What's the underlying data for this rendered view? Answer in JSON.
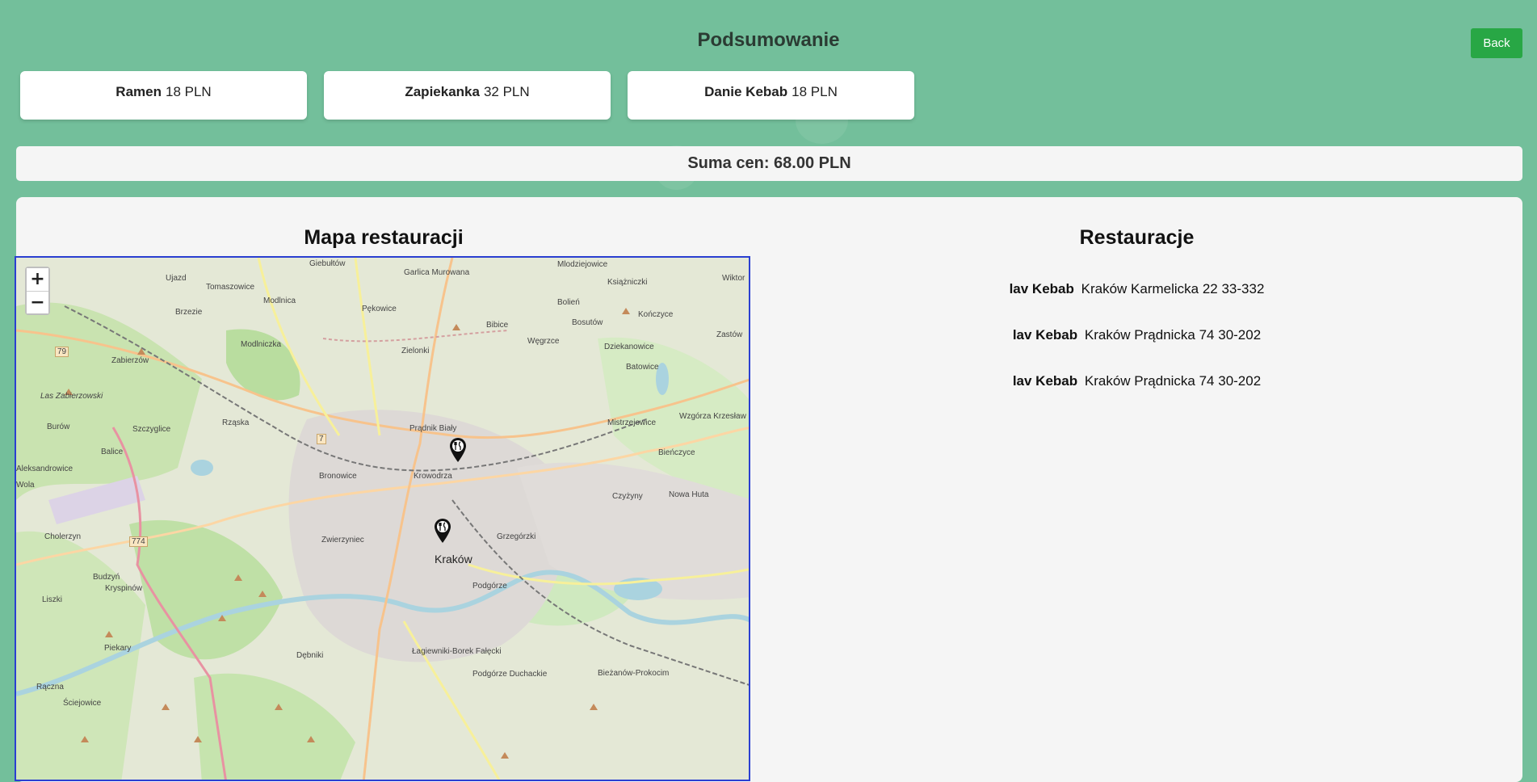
{
  "page": {
    "title": "Podsumowanie",
    "back_label": "Back"
  },
  "items": [
    {
      "name": "Ramen",
      "price": "18 PLN"
    },
    {
      "name": "Zapiekanka",
      "price": "32 PLN"
    },
    {
      "name": "Danie Kebab",
      "price": "18 PLN"
    }
  ],
  "summary": {
    "text": "Suma cen: 68.00 PLN"
  },
  "map": {
    "title": "Mapa restauracji",
    "zoom_in": "+",
    "zoom_out": "−",
    "city_label": "Kraków",
    "labels": [
      "Giebułtów",
      "Ujazd",
      "Tomaszowice",
      "Zielonki",
      "Bibice",
      "Węgrzce",
      "Bolień",
      "Bosutów",
      "Dziekanowice",
      "Batowice",
      "Zastów",
      "Wiktor",
      "Mlodziejowice",
      "Książniczki",
      "Kończyce",
      "Zabierzów",
      "Modlniczka",
      "Modlnica",
      "Brzezie",
      "Pękowice",
      "Dziekanowice",
      "Las Zabierzowski",
      "Burów",
      "Szczyglice",
      "Rząska",
      "Prądnik Biały",
      "Mistrzejowice",
      "Wzgórza Krzesław",
      "Balice",
      "Aleksandrowice",
      "Bronowice",
      "Krowodrza",
      "Bieńczyce",
      "Czyżyny",
      "Nowa Huta",
      "Cholerzyn",
      "Zwierzyniec",
      "Grzegórzki",
      "Budzyń",
      "Kryspinów",
      "Liszki",
      "Podgórze",
      "Piekary",
      "Dębniki",
      "Łagiewniki-Borek Fałęcki",
      "Podgórze Duchackie",
      "Bieżanów-Prokocim",
      "Rączna",
      "Ściejowice",
      "Garlica Murowana",
      "Wola",
      "79",
      "7",
      "774"
    ]
  },
  "restaurants": {
    "title": "Restauracje",
    "list": [
      {
        "name": "lav Kebab",
        "address": "Kraków Karmelicka 22 33-332"
      },
      {
        "name": "lav Kebab",
        "address": "Kraków Prądnicka 74 30-202"
      },
      {
        "name": "lav Kebab",
        "address": "Kraków Prądnicka 74 30-202"
      }
    ]
  },
  "colors": {
    "background": "#73bf9b",
    "back_button": "#28a745",
    "map_border": "#2a3fd1"
  },
  "icons": [
    "plus-icon",
    "minus-icon",
    "restaurant-marker-icon"
  ]
}
